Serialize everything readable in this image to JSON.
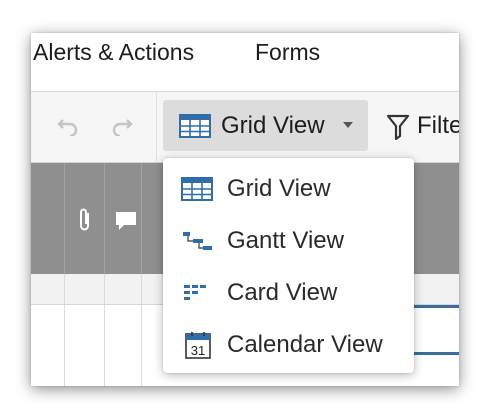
{
  "menubar": {
    "items": [
      {
        "label": "Alerts & Actions"
      },
      {
        "label": "Forms"
      }
    ]
  },
  "toolbar": {
    "undo_icon": "undo-icon",
    "redo_icon": "redo-icon",
    "view_button": {
      "label": "Grid View",
      "icon": "grid-view-icon"
    },
    "filter": {
      "label": "Filter",
      "icon": "filter-icon"
    }
  },
  "grid": {
    "header_icons": [
      "attachment-icon",
      "comment-icon"
    ]
  },
  "view_menu": {
    "items": [
      {
        "label": "Grid View",
        "icon": "grid-view-icon"
      },
      {
        "label": "Gantt View",
        "icon": "gantt-view-icon"
      },
      {
        "label": "Card View",
        "icon": "card-view-icon"
      },
      {
        "label": "Calendar View",
        "icon": "calendar-view-icon",
        "icon_text": "31"
      }
    ]
  },
  "colors": {
    "accent_blue": "#2f6ea8",
    "header_gray": "#8f8f8f",
    "active_button": "#dcdcdc"
  }
}
